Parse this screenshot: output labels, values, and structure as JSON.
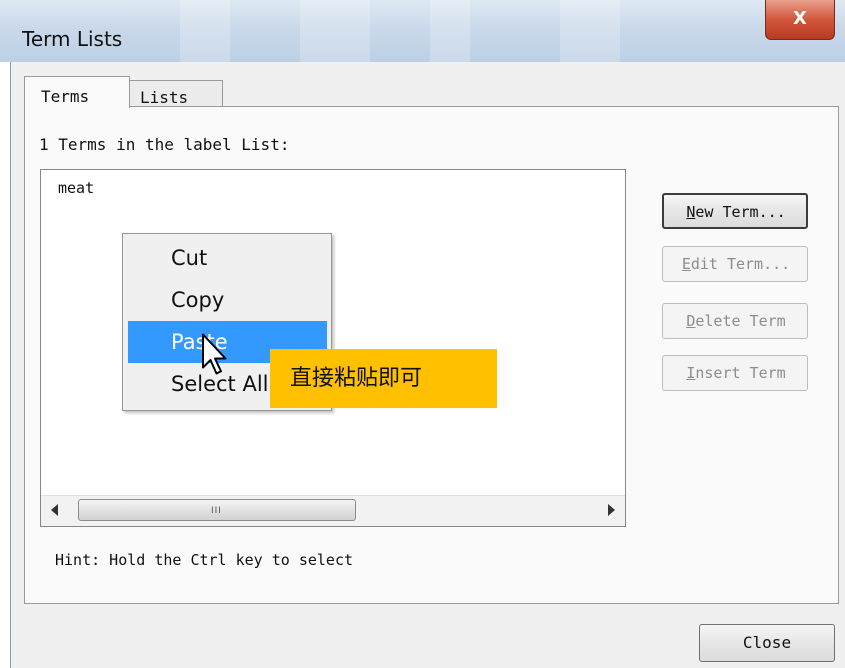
{
  "window": {
    "title": "Term Lists",
    "close_glyph": "X"
  },
  "tabs": [
    {
      "label": "Terms",
      "active": true
    },
    {
      "label": "Lists",
      "active": false
    }
  ],
  "list": {
    "count_text": "1 Terms in the label List:",
    "items": [
      "meat"
    ],
    "scroll_grip": "III"
  },
  "buttons": {
    "new_term": {
      "accel": "N",
      "rest": "ew Term...",
      "enabled": true
    },
    "edit_term": {
      "accel": "E",
      "rest": "dit Term...",
      "enabled": false
    },
    "delete_term": {
      "accel": "D",
      "rest": "elete Term",
      "enabled": false
    },
    "insert_term": {
      "accel": "I",
      "rest": "nsert Term",
      "enabled": false
    },
    "close": "Close"
  },
  "hint": "Hint: Hold the Ctrl key to select",
  "context_menu": {
    "items": [
      "Cut",
      "Copy",
      "Paste",
      "Select All"
    ],
    "highlighted": "Paste"
  },
  "annotation": "直接粘贴即可",
  "colors": {
    "highlight": "#3399ff",
    "annotation_bg": "#ffc000",
    "close_button": "#c9452e"
  },
  "icons": [
    "close-icon",
    "arrow-left-icon",
    "arrow-right-icon",
    "cursor-icon"
  ]
}
